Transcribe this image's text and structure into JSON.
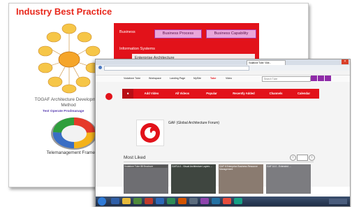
{
  "slide": {
    "title": "Industry Best Practice",
    "togaf_label": "TOGAF Architecture Development Method",
    "togaf_sub": "Test  Operate  Prodmanage  ",
    "tmf_label": "Telemanagement Framework",
    "ea_panel": {
      "tab": "Business",
      "buttons": [
        "Business Process",
        "Business Capability"
      ],
      "info_label": "Information Systems",
      "info_value": "Enterprise Architecture"
    }
  },
  "browser": {
    "tab_title": "Vodafone Tube: Vide...",
    "toolbar": [
      "Vodafone Tube",
      "Workspace",
      "Landing Page",
      "MySite",
      "Tube",
      "Video"
    ],
    "search_placeholder": "Search Tube",
    "nav": [
      "Add Video",
      "All Videos",
      "Popular",
      "Recently Added",
      "Channels",
      "Calendar"
    ],
    "channel_name": "GAF (Global Architecture Forum)",
    "section_title": "Most Liked",
    "videos": [
      {
        "title": "Vodafone Tube 88 Brochure"
      },
      {
        "title": "GAF14.0 - Visual Architecture Layers ..."
      },
      {
        "title": "GAF 6 Enterprise Business Resource Management"
      },
      {
        "title": "GAF 14.0 - Extended ..."
      }
    ]
  },
  "colors": {
    "brand": "#e2121a",
    "accent": "#8f2ba8"
  }
}
